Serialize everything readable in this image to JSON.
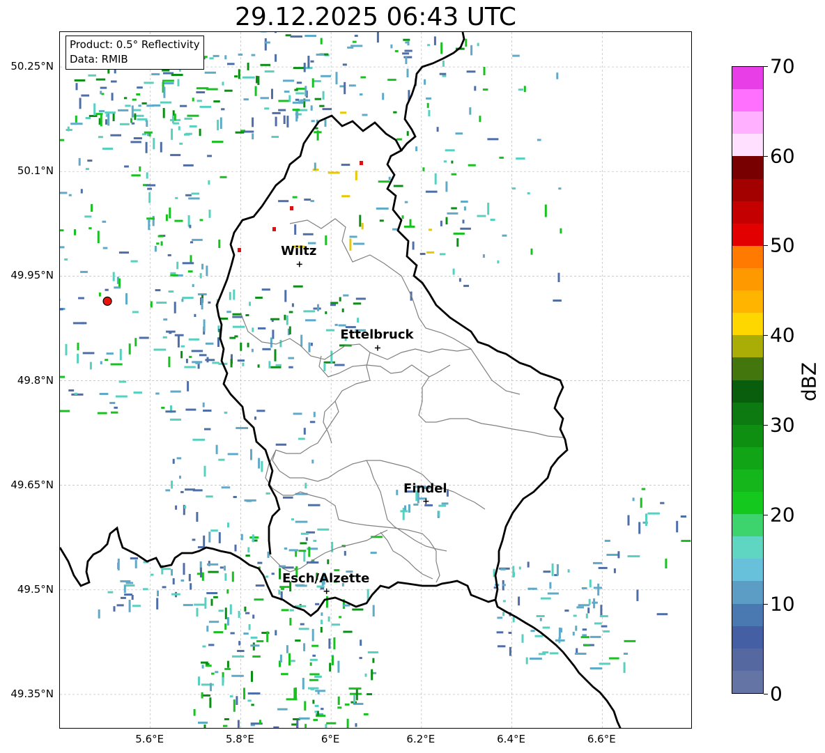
{
  "title": "29.12.2025 06:43 UTC",
  "info": {
    "product": "Product: 0.5° Reflectivity",
    "data": "Data: RMIB"
  },
  "map_extent": {
    "lon_min": 5.4,
    "lon_max": 6.8,
    "lat_min": 49.3,
    "lat_max": 50.3
  },
  "lat_ticks": [
    {
      "value": 50.25,
      "label": "50.25°N"
    },
    {
      "value": 50.1,
      "label": "50.1°N"
    },
    {
      "value": 49.95,
      "label": "49.95°N"
    },
    {
      "value": 49.8,
      "label": "49.8°N"
    },
    {
      "value": 49.65,
      "label": "49.65°N"
    },
    {
      "value": 49.5,
      "label": "49.5°N"
    },
    {
      "value": 49.35,
      "label": "49.35°N"
    }
  ],
  "lon_ticks": [
    {
      "value": 5.6,
      "label": "5.6°E"
    },
    {
      "value": 5.8,
      "label": "5.8°E"
    },
    {
      "value": 6.0,
      "label": "6°E"
    },
    {
      "value": 6.2,
      "label": "6.2°E"
    },
    {
      "value": 6.4,
      "label": "6.4°E"
    },
    {
      "value": 6.6,
      "label": "6.6°E"
    }
  ],
  "cities": [
    {
      "name": "Wiltz",
      "lon": 5.93,
      "lat": 49.967
    },
    {
      "name": "Ettelbruck",
      "lon": 6.103,
      "lat": 49.847
    },
    {
      "name": "Findel",
      "lon": 6.21,
      "lat": 49.627
    },
    {
      "name": "Esch/Alzette",
      "lon": 5.99,
      "lat": 49.498
    }
  ],
  "radar_site": {
    "lon": 5.505,
    "lat": 49.914,
    "color": "#e8140e"
  },
  "colorbar": {
    "label": "dBZ",
    "min": 0,
    "max": 70,
    "ticks": [
      0,
      10,
      20,
      30,
      40,
      50,
      60,
      70
    ],
    "colors": [
      "#6474a4",
      "#5569a0",
      "#445fa3",
      "#4a78b0",
      "#5b9dc4",
      "#67c1da",
      "#5fd6c1",
      "#3dd36d",
      "#14c81e",
      "#14b61c",
      "#12a417",
      "#0f8f12",
      "#0c7a10",
      "#085e0c",
      "#44760e",
      "#a9ad05",
      "#ffd700",
      "#ffb500",
      "#ff9900",
      "#ff7a00",
      "#e30000",
      "#c50000",
      "#a30000",
      "#780000",
      "#ffe0ff",
      "#ffb0ff",
      "#ff70ff",
      "#e83ee8"
    ]
  },
  "echo_colors": {
    "weak": "#4d6ea8",
    "light": "#5fa9c9",
    "cyan": "#58d0c0",
    "green": "#18c020",
    "darkgreen": "#0a8f14",
    "yellow": "#e8c800",
    "red": "#e01010"
  }
}
